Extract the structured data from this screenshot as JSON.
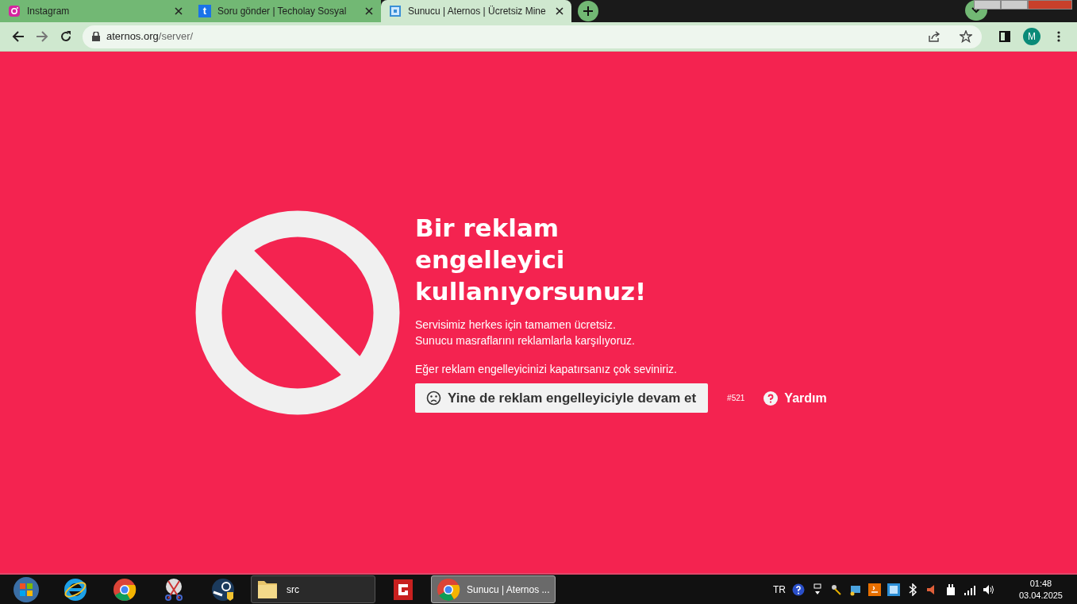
{
  "browser": {
    "tabs": [
      {
        "kind": "instagram",
        "title": "Instagram",
        "selected": false
      },
      {
        "kind": "letter",
        "favicon_text": "t",
        "title": "Soru gönder | Techolay Sosyal",
        "selected": false
      },
      {
        "kind": "grid",
        "title": "Sunucu | Aternos | Ücretsiz Mine",
        "selected": true
      }
    ],
    "address": {
      "host": "aternos.org",
      "path": "/server/"
    },
    "profile": "M"
  },
  "page": {
    "heading": "Bir reklam engelleyici kullanıyorsunuz!",
    "lines": [
      "Servisimiz herkes için tamamen ücretsiz.",
      "Sunucu masraflarını reklamlarla karşılıyoruz."
    ],
    "note": "Eğer reklam engelleyicinizi kapatırsanız çok seviniriz.",
    "continue_button": "Yine de reklam engelleyiciyle devam et",
    "code": "#521",
    "help": "Yardım"
  },
  "taskbar": {
    "items": [
      {
        "kind": "ie"
      },
      {
        "kind": "chrome"
      },
      {
        "kind": "scissors"
      },
      {
        "kind": "steam"
      },
      {
        "kind": "folder-window",
        "label": "src",
        "selected": false
      },
      {
        "kind": "game"
      },
      {
        "kind": "chrome-window",
        "label": "Sunucu | Aternos ...",
        "selected": true
      }
    ],
    "language": "TR",
    "time": "01:48",
    "date": "03.04.2025"
  }
}
